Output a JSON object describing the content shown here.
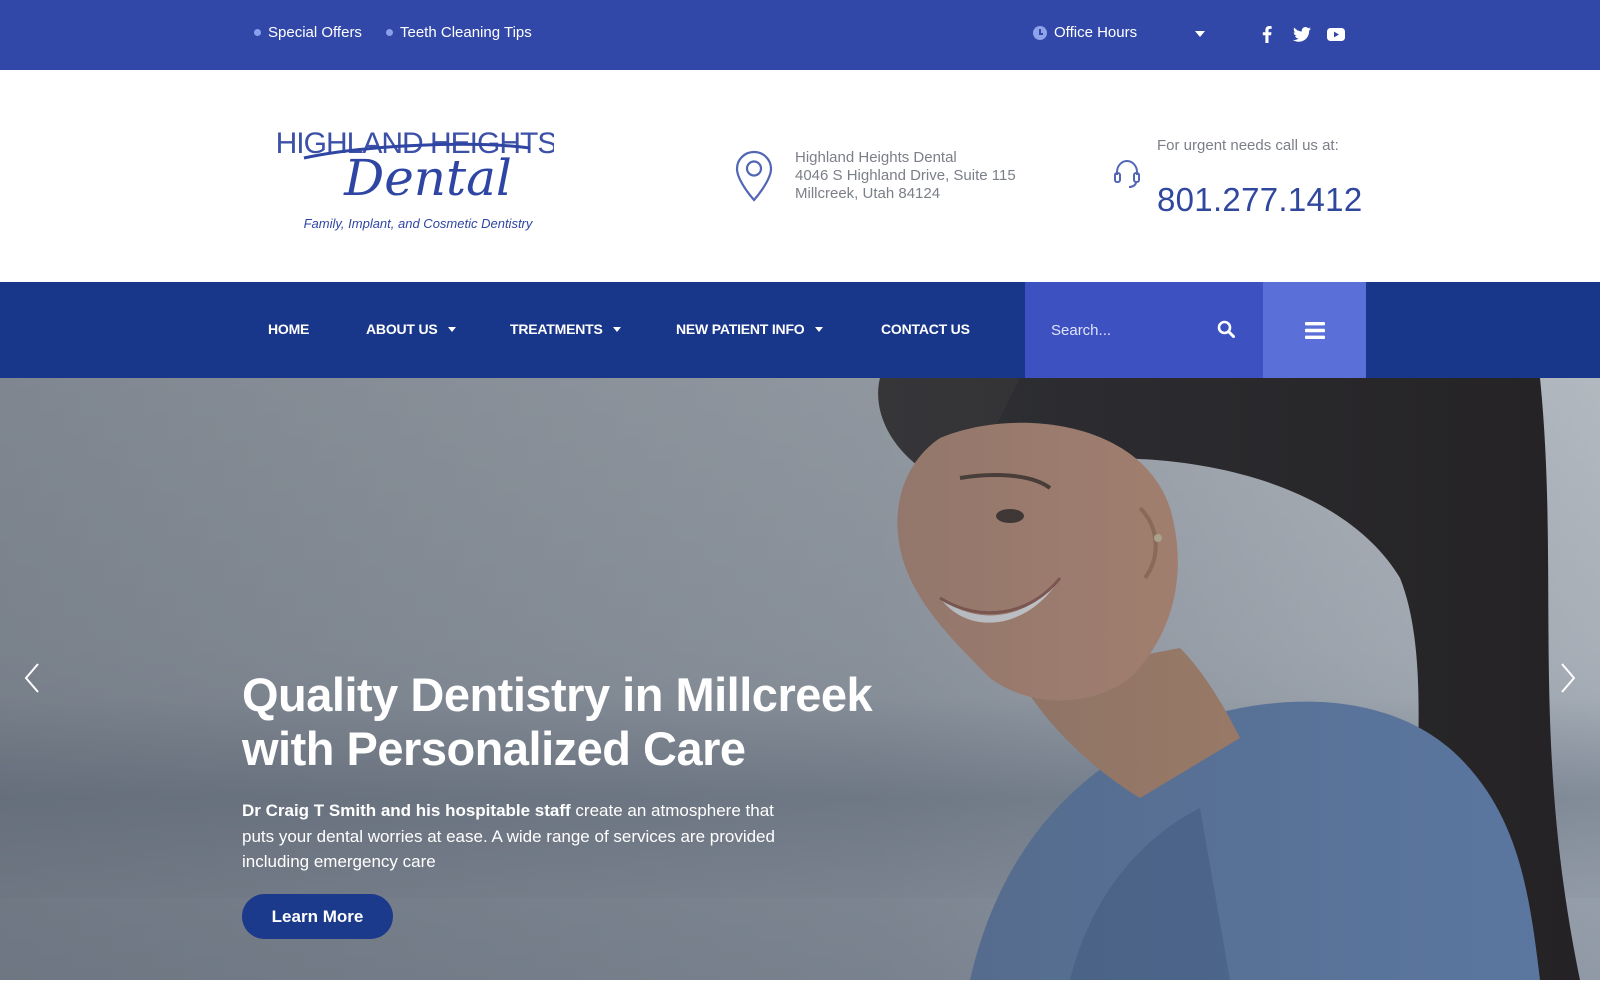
{
  "topbar": {
    "links": [
      "Special Offers",
      "Teeth Cleaning Tips"
    ],
    "hours_label": "Office Hours",
    "social_icons": [
      "facebook-icon",
      "twitter-icon",
      "youtube-icon"
    ]
  },
  "header": {
    "logo": {
      "line1": "HIGHLAND HEIGHTS",
      "line2": "Dental",
      "tagline": "Family, Implant, and Cosmetic Dentistry"
    },
    "address": {
      "name": "Highland Heights Dental",
      "street": "4046 S Highland Drive, Suite 115",
      "city": "Millcreek, Utah 84124"
    },
    "urgent_text": "For urgent needs call us at:",
    "phone": "801.277.1412"
  },
  "nav": {
    "items": [
      {
        "label": "HOME",
        "has_dropdown": false
      },
      {
        "label": "ABOUT US",
        "has_dropdown": true
      },
      {
        "label": "TREATMENTS",
        "has_dropdown": true
      },
      {
        "label": "NEW PATIENT INFO",
        "has_dropdown": true
      },
      {
        "label": "CONTACT US",
        "has_dropdown": false
      }
    ],
    "search_placeholder": "Search..."
  },
  "hero": {
    "title_line1": "Quality Dentistry in Millcreek",
    "title_line2": "with Personalized Care",
    "body_bold": "Dr Craig T Smith and his hospitable staff",
    "body_rest": " create an atmosphere that puts your dental worries at ease. A wide range of services are provided including emergency care",
    "cta_label": "Learn More"
  },
  "colors": {
    "topbar": "#3148a8",
    "nav": "#19378a",
    "search": "#3e51c0",
    "menu": "#5a70d8",
    "accent": "#30479e",
    "cta": "#1c3a8c"
  }
}
